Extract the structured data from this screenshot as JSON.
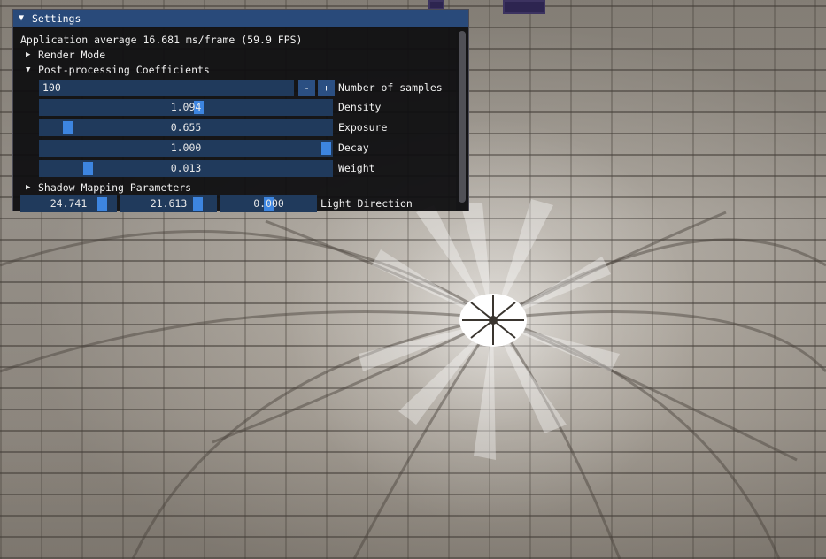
{
  "window": {
    "title": "Settings",
    "collapse_icon": "triangle-down-icon"
  },
  "stats": {
    "text": "Application average 16.681 ms/frame (59.9 FPS)"
  },
  "tree": {
    "render_mode": "Render Mode",
    "post_processing": "Post-processing Coefficients",
    "shadow_mapping": "Shadow Mapping Parameters"
  },
  "samples": {
    "value": "100",
    "minus_label": "-",
    "plus_label": "+",
    "label": "Number of samples"
  },
  "sliders": {
    "density": {
      "value": "1.094",
      "label": "Density",
      "fraction": 0.547
    },
    "exposure": {
      "value": "0.655",
      "label": "Exposure",
      "fraction": 0.08
    },
    "decay": {
      "value": "1.000",
      "label": "Decay",
      "fraction": 1.0
    },
    "weight": {
      "value": "0.013",
      "label": "Weight",
      "fraction": 0.15
    }
  },
  "light_direction": {
    "x": "24.741",
    "y": "21.613",
    "z": "0.000",
    "label": "Light Direction"
  },
  "colors": {
    "title_bar": "#294a7a",
    "frame_bg": "#203a5c",
    "slider_grab": "#3d85e0",
    "window_bg": "#0e0e10"
  }
}
